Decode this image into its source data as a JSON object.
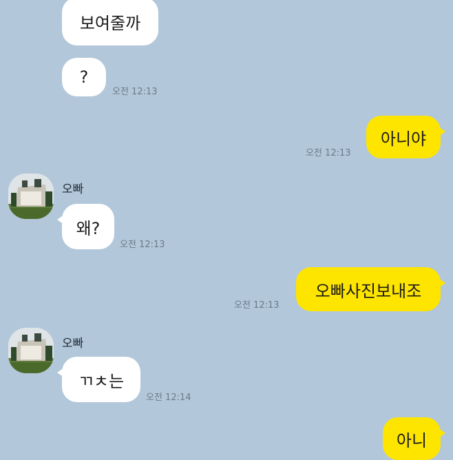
{
  "chat": {
    "partner_name": "오빠",
    "messages": [
      {
        "side": "in",
        "text": "보여줄까",
        "time": ""
      },
      {
        "side": "in",
        "text": "?",
        "time": "오전 12:13"
      },
      {
        "side": "out",
        "text": "아니야",
        "time": "오전 12:13"
      },
      {
        "side": "in",
        "sender": "오빠",
        "text": "왜?",
        "time": "오전 12:13"
      },
      {
        "side": "out",
        "text": "오빠사진보내조",
        "time": "오전 12:13"
      },
      {
        "side": "in",
        "sender": "오빠",
        "text": "ㄲㅊ는",
        "time": "오전 12:14"
      },
      {
        "side": "out",
        "text": "아니",
        "time": ""
      }
    ]
  },
  "colors": {
    "background": "#b2c7da",
    "incoming_bubble": "#ffffff",
    "outgoing_bubble": "#fee500",
    "timestamp": "#6b7a88"
  },
  "icons": {
    "avatar": "profile-photo-building"
  }
}
